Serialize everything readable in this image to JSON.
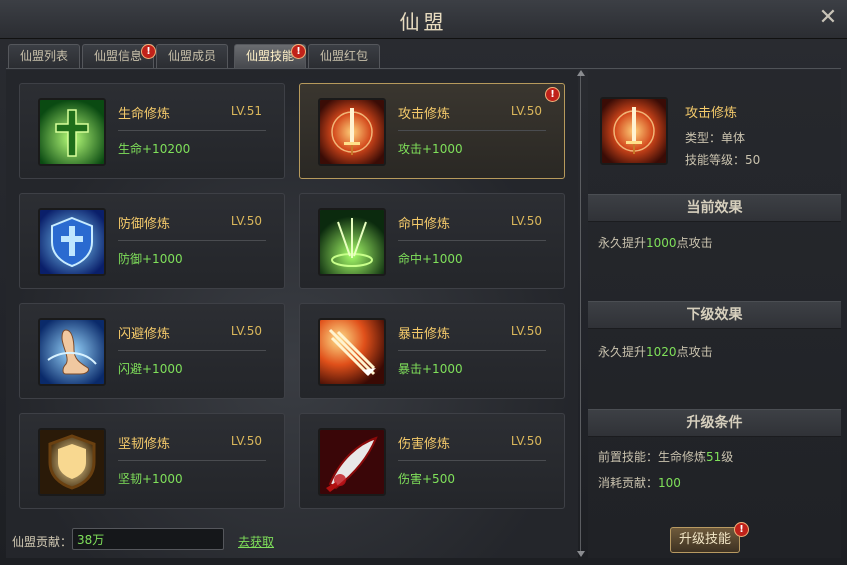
{
  "window": {
    "title": "仙盟",
    "close_icon": "close-icon"
  },
  "tabs": [
    {
      "label": "仙盟列表",
      "active": false,
      "badge": false
    },
    {
      "label": "仙盟信息",
      "active": false,
      "badge": true
    },
    {
      "label": "仙盟成员",
      "active": false,
      "badge": false
    },
    {
      "label": "仙盟技能",
      "active": true,
      "badge": true
    },
    {
      "label": "仙盟红包",
      "active": false,
      "badge": false
    }
  ],
  "badge_mark": "!",
  "skills": [
    {
      "name": "生命修炼",
      "level": "LV.51",
      "effect": "生命+10200",
      "icon": "cross-icon",
      "selected": false,
      "badge": false
    },
    {
      "name": "攻击修炼",
      "level": "LV.50",
      "effect": "攻击+1000",
      "icon": "sword-icon",
      "selected": true,
      "badge": true
    },
    {
      "name": "防御修炼",
      "level": "LV.50",
      "effect": "防御+1000",
      "icon": "shield-icon",
      "selected": false,
      "badge": false
    },
    {
      "name": "命中修炼",
      "level": "LV.50",
      "effect": "命中+1000",
      "icon": "target-arrows-icon",
      "selected": false,
      "badge": false
    },
    {
      "name": "闪避修炼",
      "level": "LV.50",
      "effect": "闪避+1000",
      "icon": "foot-swirl-icon",
      "selected": false,
      "badge": false
    },
    {
      "name": "暴击修炼",
      "level": "LV.50",
      "effect": "暴击+1000",
      "icon": "flaming-arrow-icon",
      "selected": false,
      "badge": false
    },
    {
      "name": "坚韧修炼",
      "level": "LV.50",
      "effect": "坚韧+1000",
      "icon": "golden-shield-icon",
      "selected": false,
      "badge": false
    },
    {
      "name": "伤害修炼",
      "level": "LV.50",
      "effect": "伤害+500",
      "icon": "blade-icon",
      "selected": false,
      "badge": false
    }
  ],
  "contribution": {
    "label": "仙盟贡献：",
    "value": "38万",
    "obtain_link": "去获取"
  },
  "detail": {
    "name": "攻击修炼",
    "type": "类型：单体",
    "skill_level": "技能等级：50",
    "current_title": "当前效果",
    "current_prefix": "永久提升",
    "current_value": "1000",
    "current_suffix": "点攻击",
    "next_title": "下级效果",
    "next_prefix": "永久提升",
    "next_value": "1020",
    "next_suffix": "点攻击",
    "cond_title": "升级条件",
    "pre_prefix": "前置技能：生命修炼",
    "pre_value": "51",
    "pre_suffix": "级",
    "cost_label": "消耗贡献：",
    "cost_value": "100",
    "upgrade_label": "升级技能"
  },
  "colors": {
    "gold": "#f3c96a",
    "green": "#7fe05a",
    "badge": "#c0221a",
    "selected_border": "#b79a5c"
  }
}
